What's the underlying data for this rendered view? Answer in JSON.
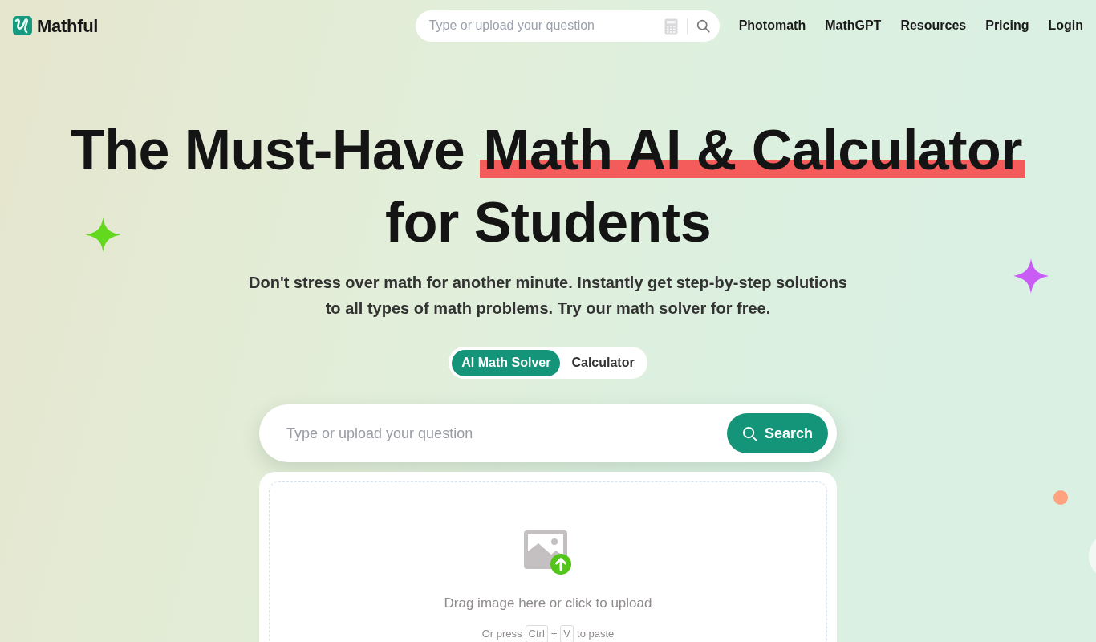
{
  "header": {
    "logo": "Mathful",
    "search": {
      "placeholder": "Type or upload your question"
    },
    "nav": [
      "Photomath",
      "MathGPT",
      "Resources",
      "Pricing",
      "Login"
    ]
  },
  "hero": {
    "headline": {
      "before": "The Must-Have ",
      "highlight": "Math AI & Calculator",
      "after": "for Students"
    },
    "subtitle": "Don't stress over math for another minute. Instantly get step-by-step solutions to all types of math problems. Try our math solver for free.",
    "modes": [
      {
        "label": "AI Math Solver",
        "selected": true
      },
      {
        "label": "Calculator",
        "selected": false
      }
    ],
    "search": {
      "placeholder": "Type or upload your question",
      "button": "Search"
    },
    "upload": {
      "prompt": "Drag image here or click to upload",
      "hint": {
        "before": "Or press",
        "keys": [
          "Ctrl",
          "V"
        ],
        "joiner": "+",
        "after": "to paste"
      }
    }
  }
}
